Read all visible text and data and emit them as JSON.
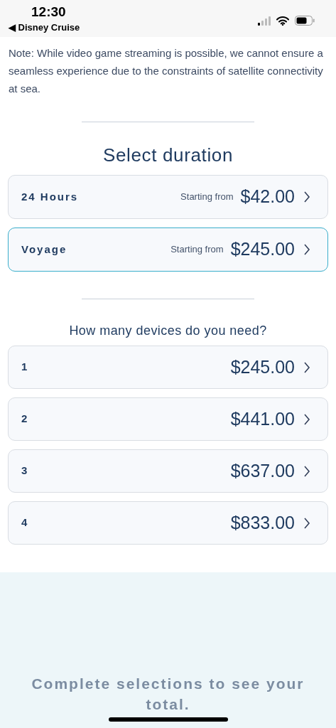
{
  "status_bar": {
    "time": "12:30",
    "back_link": "◀ Disney Cruise"
  },
  "note": "Note: While video game streaming is possible, we cannot ensure a seamless experience due to the constraints of satellite connectivity at sea.",
  "duration": {
    "title": "Select duration",
    "options": [
      {
        "label": "24 Hours",
        "prefix": "Starting from",
        "price": "$42.00",
        "selected": false
      },
      {
        "label": "Voyage",
        "prefix": "Starting from",
        "price": "$245.00",
        "selected": true
      }
    ]
  },
  "devices": {
    "title": "How many devices do you need?",
    "options": [
      {
        "label": "1",
        "price": "$245.00",
        "selected": false
      },
      {
        "label": "2",
        "price": "$441.00",
        "selected": false
      },
      {
        "label": "3",
        "price": "$637.00",
        "selected": false
      },
      {
        "label": "4",
        "price": "$833.00",
        "selected": false
      }
    ]
  },
  "footer": {
    "message": "Complete selections to see your total."
  }
}
